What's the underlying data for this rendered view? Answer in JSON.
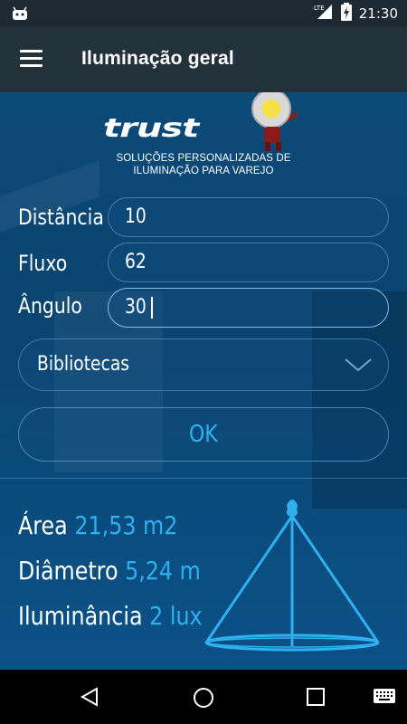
{
  "status_bar": {
    "time": "21:30",
    "network": "LTE",
    "icons": [
      "android-icon",
      "signal-icon",
      "battery-charging-icon"
    ]
  },
  "app_bar": {
    "title": "Iluminação geral",
    "menu_icon": "hamburger-menu-icon"
  },
  "logo": {
    "brand": "trust",
    "tagline_line1": "SOLUÇÕES PERSONALIZADAS DE",
    "tagline_line2": "ILUMINAÇÃO PARA VAREJO"
  },
  "form": {
    "distancia": {
      "label": "Distância",
      "value": "10"
    },
    "fluxo": {
      "label": "Fluxo",
      "value": "62"
    },
    "angulo": {
      "label": "Ângulo",
      "value": "30"
    },
    "category": {
      "selected": "Bibliotecas"
    },
    "ok_label": "OK"
  },
  "results": {
    "area_label": "Área",
    "area_value": "21,53 m2",
    "diametro_label": "Diâmetro",
    "diametro_value": "5,24 m",
    "iluminancia_label": "Iluminância",
    "iluminancia_value": "2 lux"
  },
  "colors": {
    "accent": "#2fb0f0",
    "background": "#0b4a78",
    "app_bar": "#23313a"
  },
  "nav_bar": {
    "icons": [
      "back-icon",
      "home-icon",
      "recent-apps-icon",
      "keyboard-icon"
    ]
  }
}
